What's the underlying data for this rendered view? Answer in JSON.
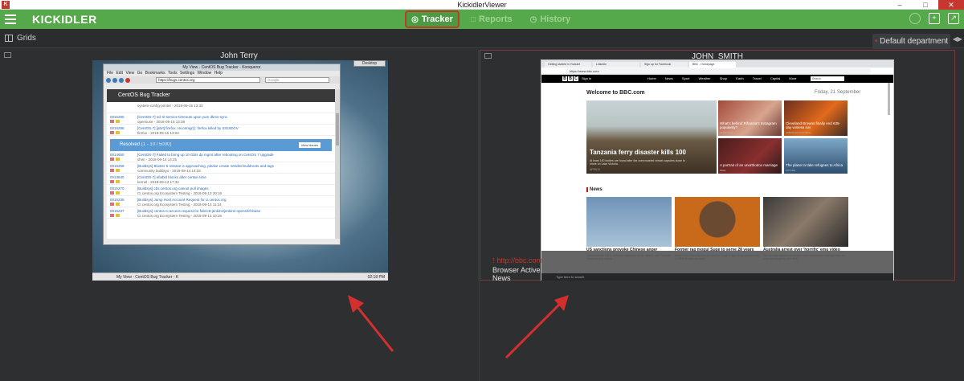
{
  "titlebar": {
    "app_icon_letter": "K",
    "title": "KickidlerViewer",
    "minimize": "–",
    "maximize": "□",
    "close": "✕"
  },
  "toolbar": {
    "logo": "KICKIDLER",
    "tabs": [
      {
        "label": "Tracker",
        "icon": "eye-icon",
        "active": true
      },
      {
        "label": "Reports",
        "icon": "document-icon",
        "active": false
      },
      {
        "label": "History",
        "icon": "clock-icon",
        "active": false
      }
    ]
  },
  "gridsbar": {
    "label": "Grids",
    "department": "Default department"
  },
  "panels": [
    {
      "user": "John Terry",
      "screen": {
        "window_title": "My View - CentOS Bug Tracker - Konqueror",
        "menu": "File Edit View Go Bookmarks Tools Settings Window Help",
        "url": "https://bugs.centos.org",
        "search_placeholder": "Google",
        "site_header": "CentOS Bug Tracker",
        "desktop_button": "Desktop",
        "resolved_label": "Resolved",
        "resolved_count": "(1 - 10 / 5000)",
        "view_issues": "View Issues",
        "rows_top": [
          {
            "id": "",
            "text": "system-config-printer - 2018-09-15 13:33",
            "sub": ""
          },
          {
            "id": "0015290",
            "text": "[CentOS-7] scl-nl-service timeouts upon yum dkms-sync",
            "sub": "opensuse - 2018-09-15 13:38"
          },
          {
            "id": "0015296",
            "text": "[CentOS-7] [abrt] firefox: reconmgr(): firefox killed by SIGSEGV",
            "sub": "firefox - 2018-09-15 13:04"
          }
        ],
        "rows_resolved": [
          {
            "id": "0014650",
            "text": "[CentOS-7] Failed to bring up 10 Gb/s dp mgmt after rebooting on CentOS 7 upgrade",
            "sub": "shim - 2018-09-14 14:25"
          },
          {
            "id": "0015268",
            "text": "[Buildsys] Bluster 5 release is approaching, please create needed buildroots and tags",
            "sub": "community buildsys - 2018-09-14 14:33"
          },
          {
            "id": "0013840",
            "text": "[CentOS-7] efiabld blocks after certain time",
            "sub": "kernel - 2018-09-13 17:32"
          },
          {
            "id": "0015270",
            "text": "[Buildsys] cbs.centos.org cannot pull images",
            "sub": "CI.centos.org Ecosystem Testing - 2018-09-13 20:16"
          },
          {
            "id": "0015235",
            "text": "[Buildsys] Jump Host Account Request for ci.centos.org",
            "sub": "CI.centos.org Ecosystem Testing - 2018-09-13 11:34"
          },
          {
            "id": "0015237",
            "text": "[Buildsys] centos-ci access request for fabric8-jenkins/jenkins-openshift-base",
            "sub": "CI.centos.org Ecosystem Testing - 2018-09-13 10:26"
          }
        ],
        "taskbar_task": "My View - CentOS Bug Tracker - K",
        "clock": "02:18 PM"
      }
    },
    {
      "user": "JOHN_SMITH",
      "url_label": "http://bbc.com",
      "activity": "Browser Active",
      "category": "News",
      "screen": {
        "tabs": [
          "Getting started in Youtube",
          "Linkedin",
          "Sign up for Facebook",
          "BBC - Homepage"
        ],
        "url": "https://www.bbc.com",
        "bbc_signin": "Sign in",
        "bbc_links": "Home News Sport Weather Shop Earth Travel Capital More",
        "bbc_search": "Search",
        "welcome": "Welcome to BBC.com",
        "date": "Friday, 21 September",
        "hero_title": "Tanzania ferry disaster kills 100",
        "hero_sub": "At least 100 bodies are found after the overcrowded vessel capsizes close to shore on Lake Victoria.",
        "hero_tag": "AFRICA",
        "tiles": [
          {
            "caption": "What's behind Rihanna's Instagram popularity?",
            "tag": "LIFESTYLE"
          },
          {
            "caption": "Cleveland Browns finally end 635-day winless run",
            "tag": "AMERICAN FOOTBALL"
          },
          {
            "caption": "A portrait of an unorthodox marriage",
            "tag": "REEL"
          },
          {
            "caption": "The plane to take refugees to Africa",
            "tag": "FUTURE"
          }
        ],
        "news_header": "News",
        "news": [
          {
            "head": "US sanctions provoke Chinese anger",
            "desc": "China tells the US to withdraw sanctions on its military over Russian weapons purchases."
          },
          {
            "head": "Former rap mogul Suge to serve 28 years",
            "desc": "Death Row Records founder Marion 'Suge' Knight is sentenced over a 2015 hit-and-run crash."
          },
          {
            "head": "Australia arrest over 'horrific' emu video",
            "desc": "The footage appears to show a man deliberately running down an emu and laughing as it dies."
          }
        ],
        "taskbar_search": "Type here to search"
      }
    }
  ],
  "colors": {
    "toolbar_green": "#56a94a",
    "active_tab_border": "#c0392b",
    "arrow_red": "#d32f2f",
    "background": "#2e2f31"
  }
}
